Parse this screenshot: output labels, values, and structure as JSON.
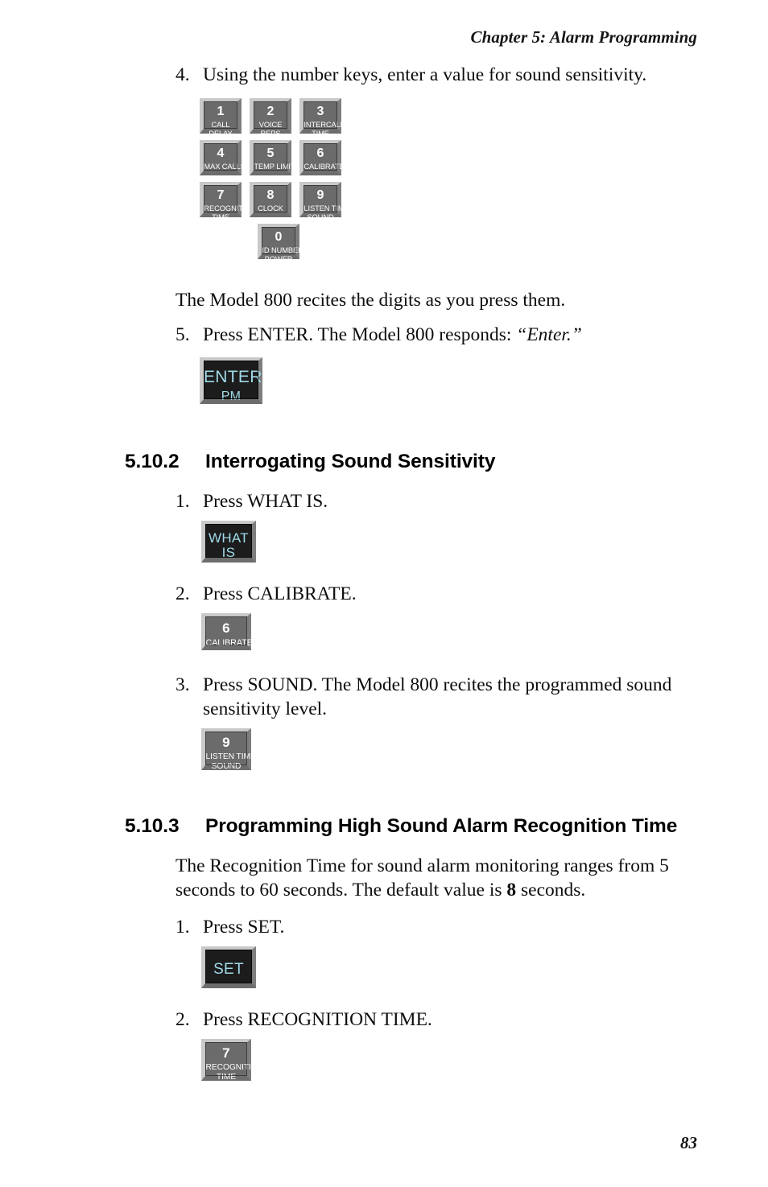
{
  "header": {
    "running_head": "Chapter 5: Alarm Programming"
  },
  "footer": {
    "page_number": "83"
  },
  "steps": {
    "step4_num": "4.",
    "step4_text": "Using the number keys, enter a value for sound sensitivity.",
    "recite_note": "The Model 800 recites the digits as you press them.",
    "step5_num": "5.",
    "step5_text_a": "Press ENTER.  The Model 800 responds: ",
    "step5_quote": "“Enter.”"
  },
  "keypad": {
    "keys": [
      {
        "digit": "1",
        "line1": "CALL",
        "line2": "DELAY"
      },
      {
        "digit": "2",
        "line1": "VOICE",
        "line2": "REPS"
      },
      {
        "digit": "3",
        "line1": "INTERCALL",
        "line2": "TIME"
      },
      {
        "digit": "4",
        "line1": "MAX CALLS",
        "line2": ""
      },
      {
        "digit": "5",
        "line1": "TEMP LIMITS",
        "line2": ""
      },
      {
        "digit": "6",
        "line1": "CALIBRATE",
        "line2": ""
      },
      {
        "digit": "7",
        "line1": "RECOGNITION",
        "line2": "TIME"
      },
      {
        "digit": "8",
        "line1": "CLOCK",
        "line2": ""
      },
      {
        "digit": "9",
        "line1": "LISTEN TIME",
        "line2": "SOUND"
      },
      {
        "digit": "0",
        "line1": "ID NUMBER",
        "line2": "POWER"
      }
    ]
  },
  "enter_key": {
    "label": "ENTER",
    "sublabel": "PM"
  },
  "section_5_10_2": {
    "number": "5.10.2",
    "title": "Interrogating Sound Sensitivity",
    "step1_num": "1.",
    "step1_text": "Press WHAT IS.",
    "whatis_key": {
      "label": "WHAT",
      "sublabel": "IS"
    },
    "step2_num": "2.",
    "step2_text": "Press CALIBRATE.",
    "calibrate_key": {
      "digit": "6",
      "line1": "CALIBRATE",
      "line2": ""
    },
    "step3_num": "3.",
    "step3_text": "Press SOUND. The Model 800 recites the programmed sound sensitivity level.",
    "sound_key": {
      "digit": "9",
      "line1": "LISTEN TIME",
      "line2": "SOUND"
    }
  },
  "section_5_10_3": {
    "number": "5.10.3",
    "title": "Programming High Sound Alarm Recognition Time",
    "intro_a": "The Recognition Time for sound alarm monitoring ranges from 5 seconds to 60 seconds. The default value is ",
    "intro_bold": "8",
    "intro_b": " seconds.",
    "step1_num": "1.",
    "step1_text": "Press SET.",
    "set_key": {
      "label": "SET"
    },
    "step2_num": "2.",
    "step2_text": "Press RECOGNITION TIME.",
    "recognition_key": {
      "digit": "7",
      "line1": "RECOGNITION",
      "line2": "TIME"
    }
  },
  "colors": {
    "key_face_gray": "#6b6b6b",
    "key_face_dark": "#1c1c1c",
    "key_text_cyan": "#9fd9e8",
    "bevel_light": "#c9c9c9",
    "bevel_dark": "#6d6d6d",
    "text": "#101010"
  }
}
